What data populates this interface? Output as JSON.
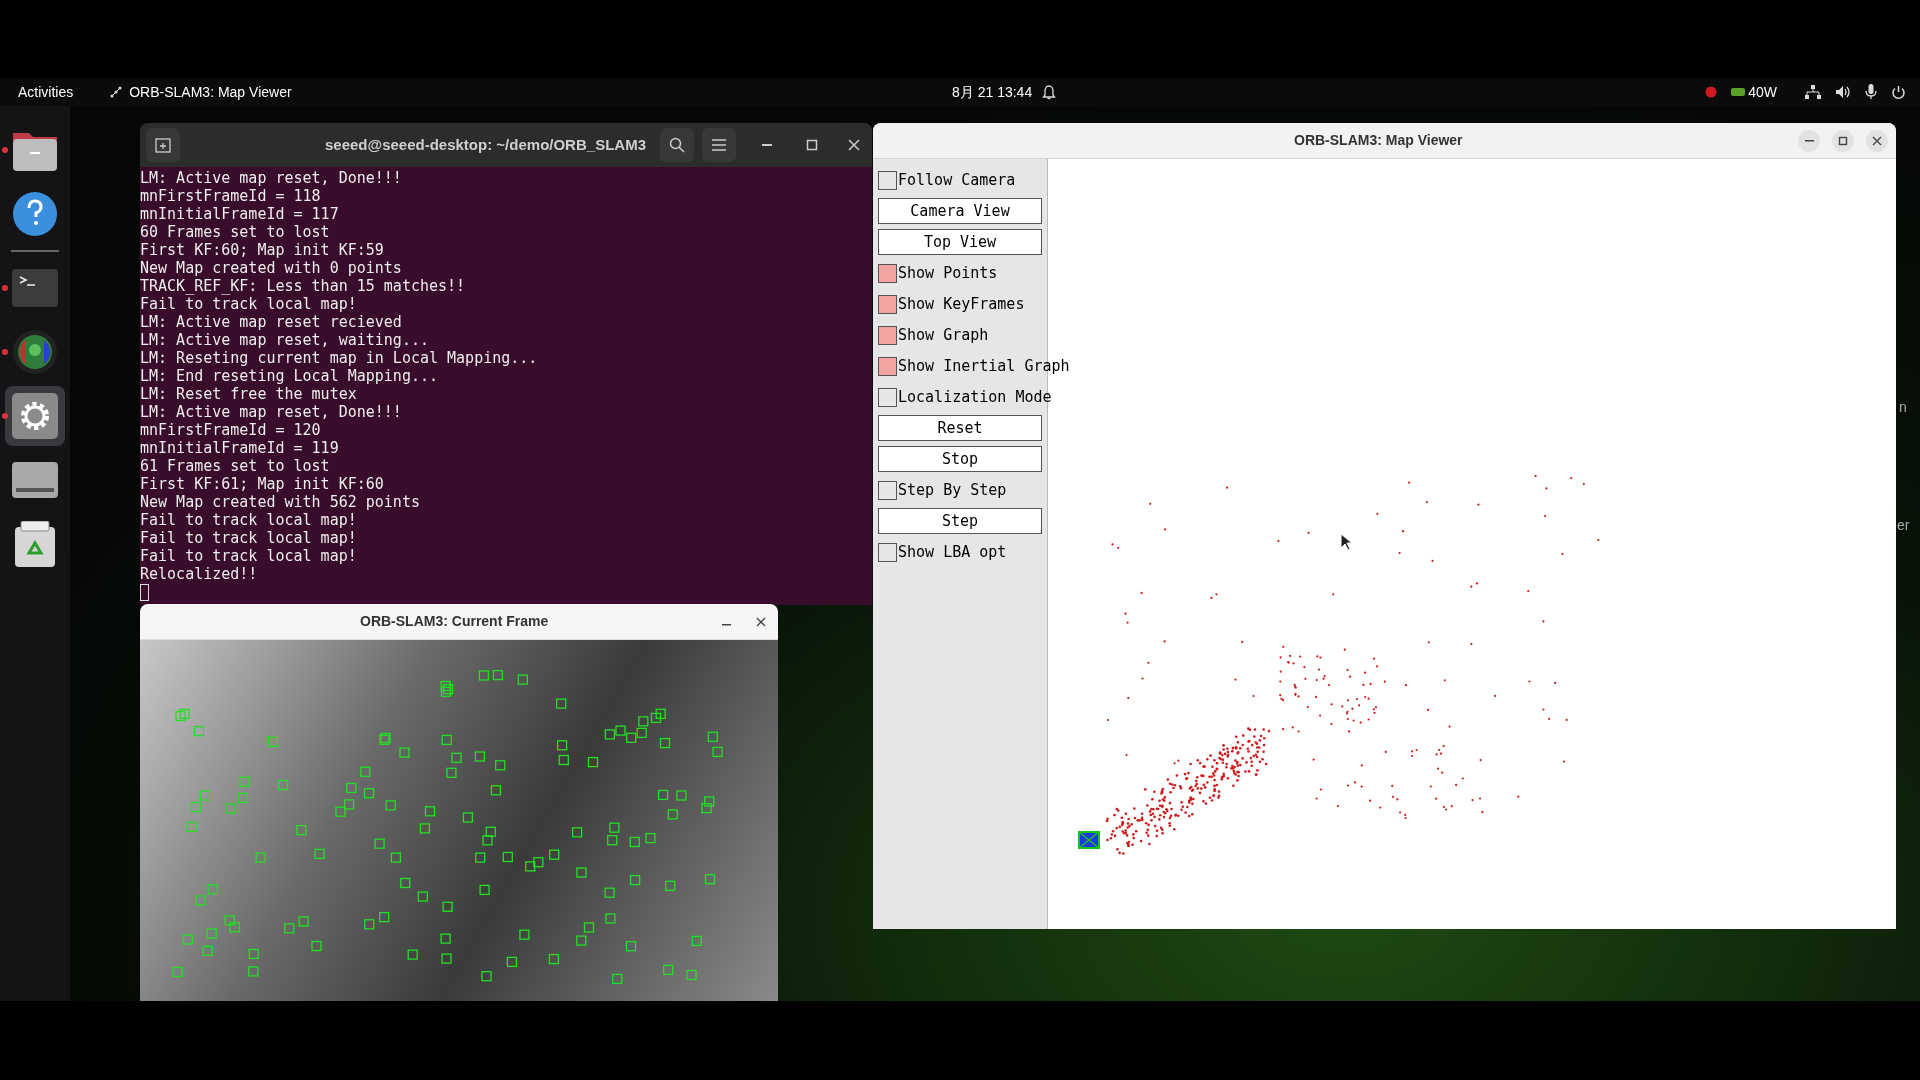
{
  "top_bar": {
    "activities": "Activities",
    "app_name": "ORB-SLAM3: Map Viewer",
    "date": "8月 21",
    "time": "13:44",
    "power": "40W"
  },
  "dock": [
    {
      "kind": "files",
      "running": true,
      "selected": false
    },
    {
      "kind": "help",
      "running": false,
      "selected": false
    },
    {
      "kind": "terminal",
      "running": true,
      "selected": false
    },
    {
      "kind": "camera",
      "running": true,
      "selected": false
    },
    {
      "kind": "settings",
      "running": true,
      "selected": true
    },
    {
      "kind": "drive",
      "running": false,
      "selected": false
    },
    {
      "kind": "trash",
      "running": false,
      "selected": false
    }
  ],
  "terminal": {
    "title": "seeed@seeed-desktop: ~/demo/ORB_SLAM3",
    "lines": [
      "LM: Active map reset, Done!!!",
      "mnFirstFrameId = 118",
      "mnInitialFrameId = 117",
      "60 Frames set to lost",
      "First KF:60; Map init KF:59",
      "New Map created with 0 points",
      "TRACK_REF_KF: Less than 15 matches!!",
      "Fail to track local map!",
      "LM: Active map reset recieved",
      "LM: Active map reset, waiting...",
      "LM: Reseting current map in Local Mapping...",
      "LM: End reseting Local Mapping...",
      "LM: Reset free the mutex",
      "LM: Active map reset, Done!!!",
      "mnFirstFrameId = 120",
      "mnInitialFrameId = 119",
      "61 Frames set to lost",
      "First KF:61; Map init KF:60",
      "New Map created with 562 points",
      "Fail to track local map!",
      "Fail to track local map!",
      "Fail to track local map!",
      "Relocalized!!"
    ]
  },
  "current_frame": {
    "title": "ORB-SLAM3: Current Frame"
  },
  "map_viewer": {
    "title": "ORB-SLAM3: Map Viewer",
    "controls": [
      {
        "kind": "checkbox",
        "label": "Follow Camera",
        "checked": false
      },
      {
        "kind": "button",
        "label": "Camera View"
      },
      {
        "kind": "button",
        "label": "Top View"
      },
      {
        "kind": "checkbox",
        "label": "Show Points",
        "checked": true
      },
      {
        "kind": "checkbox",
        "label": "Show KeyFrames",
        "checked": true
      },
      {
        "kind": "checkbox",
        "label": "Show Graph",
        "checked": true
      },
      {
        "kind": "checkbox",
        "label": "Show Inertial Graph",
        "checked": true
      },
      {
        "kind": "checkbox",
        "label": "Localization Mode",
        "checked": false
      },
      {
        "kind": "button",
        "label": "Reset"
      },
      {
        "kind": "button",
        "label": "Stop"
      },
      {
        "kind": "checkbox",
        "label": "Step By Step",
        "checked": false
      },
      {
        "kind": "button",
        "label": "Step"
      },
      {
        "kind": "checkbox",
        "label": "Show LBA opt",
        "checked": false
      }
    ]
  },
  "background_fragments": [
    "n",
    "er"
  ]
}
